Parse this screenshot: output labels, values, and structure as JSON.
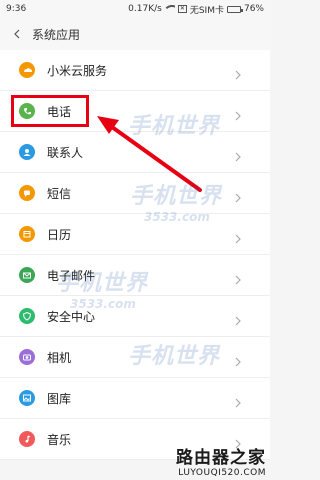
{
  "status": {
    "time": "9:36",
    "speed": "0.17K/s",
    "sim_text": "无SIM卡",
    "battery": "76%",
    "battery_level": 0.76
  },
  "header": {
    "title": "系统应用"
  },
  "items": [
    {
      "label": "小米云服务",
      "icon": "cloud-icon",
      "color": "#f39800"
    },
    {
      "label": "电话",
      "icon": "phone-icon",
      "color": "#5bb34d"
    },
    {
      "label": "联系人",
      "icon": "contact-icon",
      "color": "#2a9ae3"
    },
    {
      "label": "短信",
      "icon": "message-icon",
      "color": "#f39800"
    },
    {
      "label": "日历",
      "icon": "calendar-icon",
      "color": "#f39800"
    },
    {
      "label": "电子邮件",
      "icon": "mail-icon",
      "color": "#3aa656"
    },
    {
      "label": "安全中心",
      "icon": "shield-icon",
      "color": "#2dbb6e"
    },
    {
      "label": "相机",
      "icon": "camera-icon",
      "color": "#9b6fd8"
    },
    {
      "label": "图库",
      "icon": "gallery-icon",
      "color": "#2a9ae3"
    },
    {
      "label": "音乐",
      "icon": "music-icon",
      "color": "#f05a5a"
    }
  ],
  "watermark": {
    "brand": "手机世界",
    "sub": "3533.com"
  },
  "footer": {
    "line1": "路由器之家",
    "line2": "LUYOUQI520.COM"
  },
  "accent": "#e60012"
}
